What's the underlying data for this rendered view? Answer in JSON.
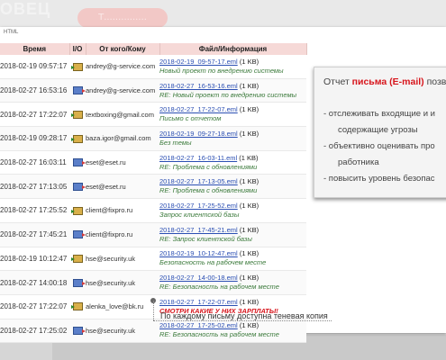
{
  "background": {
    "brand_fragment": "ОВЕЦ",
    "button_fragment": "Т..............."
  },
  "html_label": "HTML",
  "table": {
    "columns": [
      "Время",
      "I/O",
      "От кого/Кому",
      "Файл/Информация"
    ],
    "rows": [
      {
        "time": "2018-02-19 09:57:17",
        "io": "in",
        "from": "andrey@g-service.com",
        "file": "2018-02-19_09-57-17.eml",
        "size": "(1 KB)",
        "subject": "Новый проект по внедрению системы",
        "alert": false
      },
      {
        "time": "2018-02-27 16:53:16",
        "io": "out",
        "from": "andrey@g-service.com",
        "file": "2018-02-27_16-53-16.eml",
        "size": "(1 KB)",
        "subject": "RE: Новый проект по внедрению системы",
        "alert": false
      },
      {
        "time": "2018-02-27 17:22:07",
        "io": "in",
        "from": "textboxing@gmail.com",
        "file": "2018-02-27_17-22-07.eml",
        "size": "(1 KB)",
        "subject": "Письмо с отчетом",
        "alert": false
      },
      {
        "time": "2018-02-19 09:28:17",
        "io": "in",
        "from": "baza.igor@gmail.com",
        "file": "2018-02-19_09-27-18.eml",
        "size": "(1 KB)",
        "subject": "Без темы",
        "alert": false
      },
      {
        "time": "2018-02-27 16:03:11",
        "io": "out",
        "from": "eset@eset.ru",
        "file": "2018-02-27_16-03-11.eml",
        "size": "(1 KB)",
        "subject": "RE: Проблема с обновлениями",
        "alert": false
      },
      {
        "time": "2018-02-27 17:13:05",
        "io": "out",
        "from": "eset@eset.ru",
        "file": "2018-02-27_17-13-05.eml",
        "size": "(1 KB)",
        "subject": "RE: Проблема с обновлениями",
        "alert": false
      },
      {
        "time": "2018-02-27 17:25:52",
        "io": "in",
        "from": "client@fixpro.ru",
        "file": "2018-02-27_17-25-52.eml",
        "size": "(1 KB)",
        "subject": "Запрос клиентской базы",
        "alert": false
      },
      {
        "time": "2018-02-27 17:45:21",
        "io": "out",
        "from": "client@fixpro.ru",
        "file": "2018-02-27_17-45-21.eml",
        "size": "(1 KB)",
        "subject": "RE: Запрос клиентской базы",
        "alert": false
      },
      {
        "time": "2018-02-19 10:12:47",
        "io": "in",
        "from": "hse@security.uk",
        "file": "2018-02-19_10-12-47.eml",
        "size": "(1 KB)",
        "subject": "Безопасность на рабочем месте",
        "alert": false
      },
      {
        "time": "2018-02-27 14:00:18",
        "io": "out",
        "from": "hse@security.uk",
        "file": "2018-02-27_14-00-18.eml",
        "size": "(1 KB)",
        "subject": "RE: Безопасность на рабочем месте",
        "alert": false
      },
      {
        "time": "2018-02-27 17:22:07",
        "io": "in",
        "from": "alenka_love@bk.ru",
        "file": "2018-02-27_17-22-07.eml",
        "size": "(1 KB)",
        "subject": "СМОТРИ КАКИЕ У НИХ ЗАРПЛАТЫ!",
        "alert": true
      },
      {
        "time": "2018-02-27 17:25:02",
        "io": "out",
        "from": "hse@security.uk",
        "file": "2018-02-27_17-25-02.eml",
        "size": "(1 KB)",
        "subject": "RE: Безопасность на рабочем месте",
        "alert": false
      }
    ]
  },
  "callout": {
    "title_prefix": "Отчет ",
    "title_highlight": "письма (E-mail)",
    "title_suffix": " позво",
    "items": [
      "- отслеживать входящие и и",
      "содержащие угрозы",
      "- объективно оценивать про",
      "работника",
      "- повысить уровень безопас"
    ]
  },
  "note": "По каждому письму доступна теневая копия",
  "colors": {
    "header_bg": "#f6d9d7",
    "link": "#2b4fb3",
    "subject": "#3b7a3b",
    "alert": "#d7151c"
  }
}
